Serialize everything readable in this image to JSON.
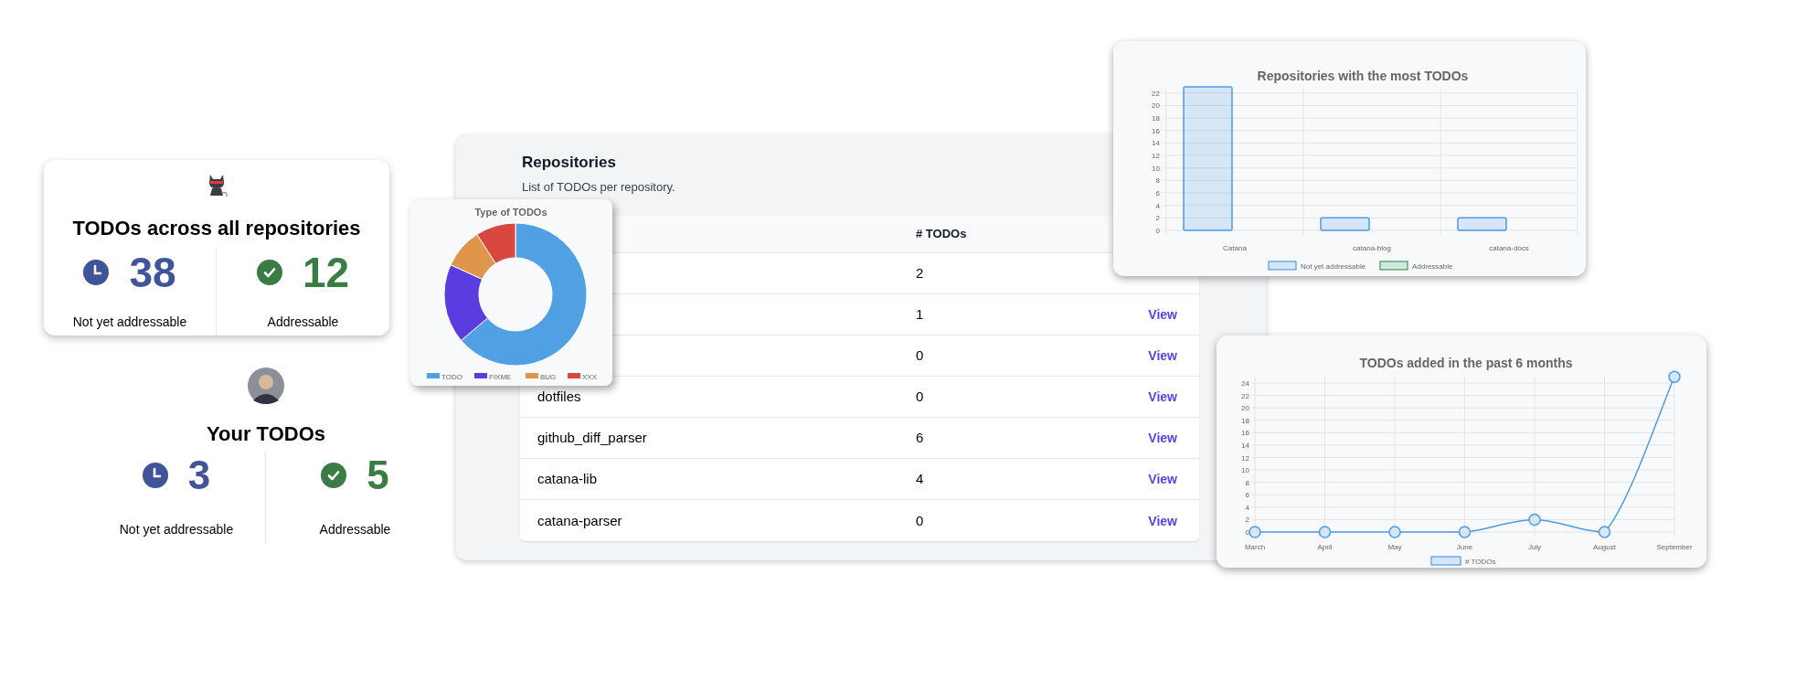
{
  "overall": {
    "title": "TODOs across all repositories",
    "stats": [
      {
        "kind": "pending",
        "value": "38",
        "label": "Not yet addressable"
      },
      {
        "kind": "done",
        "value": "12",
        "label": "Addressable"
      }
    ]
  },
  "mine": {
    "title": "Your TODOs",
    "stats": [
      {
        "kind": "pending",
        "value": "3",
        "label": "Not yet addressable"
      },
      {
        "kind": "done",
        "value": "5",
        "label": "Addressable"
      }
    ]
  },
  "repositories": {
    "title": "Repositories",
    "subtitle": "List of TODOs per repository.",
    "count_heading": "# TODOs",
    "rows": [
      {
        "count": "2"
      },
      {
        "count": "1",
        "action": "View"
      },
      {
        "count": "0",
        "action": "View"
      },
      {
        "name": "dotfiles",
        "count": "0",
        "action": "View"
      },
      {
        "name": "github_diff_parser",
        "count": "6",
        "action": "View"
      },
      {
        "name": "catana-lib",
        "count": "4",
        "action": "View"
      },
      {
        "name": "catana-parser",
        "count": "0",
        "action": "View"
      }
    ]
  },
  "todo_types": {
    "title": "Type of TODOs",
    "legend": [
      {
        "label": "TODO",
        "color": "#52a0e4"
      },
      {
        "label": "FIXME",
        "color": "#5b3ce0"
      },
      {
        "label": "BUG",
        "color": "#e0964a"
      },
      {
        "label": "XXX",
        "color": "#d9473f"
      }
    ]
  },
  "top_repositories": {
    "chart_data": {
      "type": "bar",
      "title": "Repositories with the most TODOs",
      "categories": [
        "Catana",
        "catana-blog",
        "catana-docs"
      ],
      "series": [
        {
          "name": "Not yet addressable",
          "color": "#4e9be6",
          "values": [
            23,
            2,
            2
          ]
        },
        {
          "name": "Addressable",
          "color": "#3c9a5f",
          "values": [
            0,
            0,
            0
          ]
        }
      ],
      "ylim": [
        0,
        23
      ],
      "yticks": [
        0,
        2,
        4,
        6,
        8,
        10,
        12,
        14,
        16,
        18,
        20,
        22
      ],
      "grid": true
    }
  },
  "recent": {
    "chart_data": {
      "type": "line",
      "title": "TODOs added in the past 6 months",
      "categories": [
        "March",
        "April",
        "May",
        "June",
        "July",
        "August",
        "September"
      ],
      "series": [
        {
          "name": "# TODOs",
          "color": "#4e9be6",
          "values": [
            0,
            0,
            0,
            0,
            2,
            0,
            25
          ],
          "marker": "circle"
        }
      ],
      "ylim": [
        0,
        25
      ],
      "yticks": [
        0,
        2,
        4,
        6,
        8,
        10,
        12,
        14,
        16,
        18,
        20,
        22,
        24
      ],
      "grid": true
    }
  }
}
